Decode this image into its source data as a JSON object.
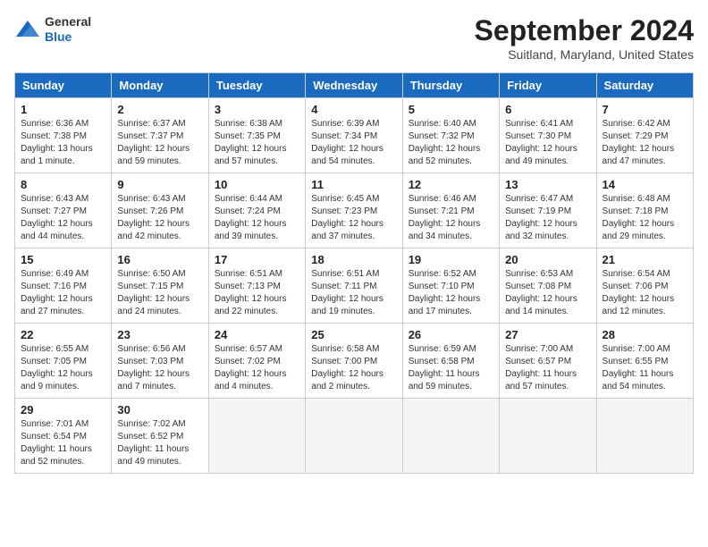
{
  "header": {
    "logo_line1": "General",
    "logo_line2": "Blue",
    "title": "September 2024",
    "subtitle": "Suitland, Maryland, United States"
  },
  "days_of_week": [
    "Sunday",
    "Monday",
    "Tuesday",
    "Wednesday",
    "Thursday",
    "Friday",
    "Saturday"
  ],
  "weeks": [
    [
      {
        "num": "1",
        "info": "Sunrise: 6:36 AM\nSunset: 7:38 PM\nDaylight: 13 hours\nand 1 minute."
      },
      {
        "num": "2",
        "info": "Sunrise: 6:37 AM\nSunset: 7:37 PM\nDaylight: 12 hours\nand 59 minutes."
      },
      {
        "num": "3",
        "info": "Sunrise: 6:38 AM\nSunset: 7:35 PM\nDaylight: 12 hours\nand 57 minutes."
      },
      {
        "num": "4",
        "info": "Sunrise: 6:39 AM\nSunset: 7:34 PM\nDaylight: 12 hours\nand 54 minutes."
      },
      {
        "num": "5",
        "info": "Sunrise: 6:40 AM\nSunset: 7:32 PM\nDaylight: 12 hours\nand 52 minutes."
      },
      {
        "num": "6",
        "info": "Sunrise: 6:41 AM\nSunset: 7:30 PM\nDaylight: 12 hours\nand 49 minutes."
      },
      {
        "num": "7",
        "info": "Sunrise: 6:42 AM\nSunset: 7:29 PM\nDaylight: 12 hours\nand 47 minutes."
      }
    ],
    [
      {
        "num": "8",
        "info": "Sunrise: 6:43 AM\nSunset: 7:27 PM\nDaylight: 12 hours\nand 44 minutes."
      },
      {
        "num": "9",
        "info": "Sunrise: 6:43 AM\nSunset: 7:26 PM\nDaylight: 12 hours\nand 42 minutes."
      },
      {
        "num": "10",
        "info": "Sunrise: 6:44 AM\nSunset: 7:24 PM\nDaylight: 12 hours\nand 39 minutes."
      },
      {
        "num": "11",
        "info": "Sunrise: 6:45 AM\nSunset: 7:23 PM\nDaylight: 12 hours\nand 37 minutes."
      },
      {
        "num": "12",
        "info": "Sunrise: 6:46 AM\nSunset: 7:21 PM\nDaylight: 12 hours\nand 34 minutes."
      },
      {
        "num": "13",
        "info": "Sunrise: 6:47 AM\nSunset: 7:19 PM\nDaylight: 12 hours\nand 32 minutes."
      },
      {
        "num": "14",
        "info": "Sunrise: 6:48 AM\nSunset: 7:18 PM\nDaylight: 12 hours\nand 29 minutes."
      }
    ],
    [
      {
        "num": "15",
        "info": "Sunrise: 6:49 AM\nSunset: 7:16 PM\nDaylight: 12 hours\nand 27 minutes."
      },
      {
        "num": "16",
        "info": "Sunrise: 6:50 AM\nSunset: 7:15 PM\nDaylight: 12 hours\nand 24 minutes."
      },
      {
        "num": "17",
        "info": "Sunrise: 6:51 AM\nSunset: 7:13 PM\nDaylight: 12 hours\nand 22 minutes."
      },
      {
        "num": "18",
        "info": "Sunrise: 6:51 AM\nSunset: 7:11 PM\nDaylight: 12 hours\nand 19 minutes."
      },
      {
        "num": "19",
        "info": "Sunrise: 6:52 AM\nSunset: 7:10 PM\nDaylight: 12 hours\nand 17 minutes."
      },
      {
        "num": "20",
        "info": "Sunrise: 6:53 AM\nSunset: 7:08 PM\nDaylight: 12 hours\nand 14 minutes."
      },
      {
        "num": "21",
        "info": "Sunrise: 6:54 AM\nSunset: 7:06 PM\nDaylight: 12 hours\nand 12 minutes."
      }
    ],
    [
      {
        "num": "22",
        "info": "Sunrise: 6:55 AM\nSunset: 7:05 PM\nDaylight: 12 hours\nand 9 minutes."
      },
      {
        "num": "23",
        "info": "Sunrise: 6:56 AM\nSunset: 7:03 PM\nDaylight: 12 hours\nand 7 minutes."
      },
      {
        "num": "24",
        "info": "Sunrise: 6:57 AM\nSunset: 7:02 PM\nDaylight: 12 hours\nand 4 minutes."
      },
      {
        "num": "25",
        "info": "Sunrise: 6:58 AM\nSunset: 7:00 PM\nDaylight: 12 hours\nand 2 minutes."
      },
      {
        "num": "26",
        "info": "Sunrise: 6:59 AM\nSunset: 6:58 PM\nDaylight: 11 hours\nand 59 minutes."
      },
      {
        "num": "27",
        "info": "Sunrise: 7:00 AM\nSunset: 6:57 PM\nDaylight: 11 hours\nand 57 minutes."
      },
      {
        "num": "28",
        "info": "Sunrise: 7:00 AM\nSunset: 6:55 PM\nDaylight: 11 hours\nand 54 minutes."
      }
    ],
    [
      {
        "num": "29",
        "info": "Sunrise: 7:01 AM\nSunset: 6:54 PM\nDaylight: 11 hours\nand 52 minutes."
      },
      {
        "num": "30",
        "info": "Sunrise: 7:02 AM\nSunset: 6:52 PM\nDaylight: 11 hours\nand 49 minutes."
      },
      null,
      null,
      null,
      null,
      null
    ]
  ]
}
